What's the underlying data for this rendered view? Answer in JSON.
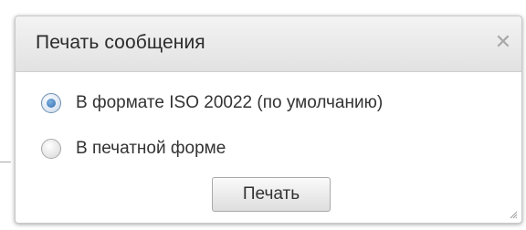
{
  "dialog": {
    "title": "Печать сообщения",
    "close_icon": "close-icon",
    "options": [
      {
        "label": "В формате ISO 20022 (по умолчанию)",
        "checked": true
      },
      {
        "label": "В печатной форме",
        "checked": false
      }
    ],
    "print_label": "Печать",
    "resize_icon": "resize-grip-icon"
  },
  "colors": {
    "radio_selected": "#2f6fb0",
    "title_bar": "#e8e8e8",
    "text": "#333333"
  }
}
